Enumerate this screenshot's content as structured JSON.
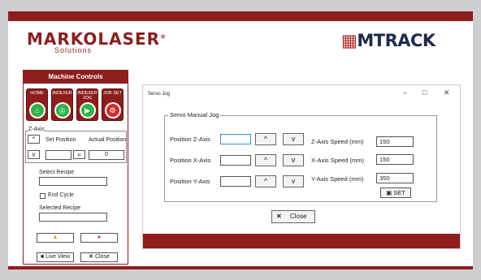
{
  "brand": {
    "left_logo": "MARKOLASER",
    "left_logo_reg": "®",
    "left_sub": "Solutions",
    "right_logo": "MTRACK"
  },
  "machine_controls": {
    "title": "Machine Controls",
    "buttons": [
      {
        "label": "HOME",
        "icon": "home-icon"
      },
      {
        "label": "INDEXER",
        "icon": "target-icon"
      },
      {
        "label": "INDEXER JOG",
        "icon": "play-icon"
      },
      {
        "label": "JOB SET",
        "icon": "gear-icon"
      }
    ],
    "z_axis": {
      "label": "Z-Axis",
      "set_position_label": "Set Position",
      "actual_position_label": "Actual Position",
      "set_position_value": "",
      "actual_position_value": "0"
    },
    "select_recipe_label": "Select Recipe",
    "select_recipe_value": "",
    "end_cycle_label": "End Cycle",
    "selected_recipe_label": "Selected Recipe",
    "selected_recipe_value": "",
    "live_view_label": "Live View",
    "close_label": "Close"
  },
  "dialog": {
    "title": "Servo Jog",
    "group_label": "Servo Manual Jog",
    "rows": [
      {
        "label": "Position Z-Axis",
        "value": "",
        "speed_label": "Z-Axis Speed (mm)",
        "speed_value": "150"
      },
      {
        "label": "Position X-Axis",
        "value": "",
        "speed_label": "X-Axis Speed (mm)",
        "speed_value": "150"
      },
      {
        "label": "Position Y-Axis",
        "value": "",
        "speed_label": "Y-Axis Speed (mm)",
        "speed_value": "350"
      }
    ],
    "set_label": "SET",
    "close_label": "Close"
  },
  "colors": {
    "brand_red": "#8e1d1d",
    "brand_navy": "#1e2b4e",
    "go_green": "#2db34a",
    "stop_red": "#d52b2b",
    "focus_blue": "#3a8ee6"
  }
}
